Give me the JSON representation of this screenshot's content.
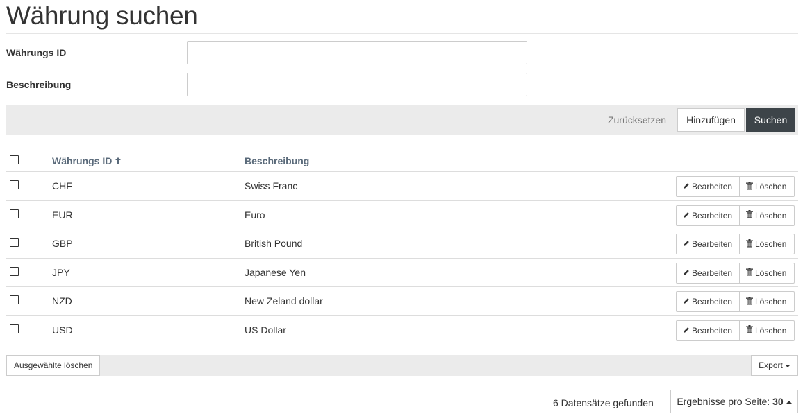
{
  "page": {
    "title": "Währung suchen"
  },
  "form": {
    "id_label": "Währungs ID",
    "id_value": "",
    "desc_label": "Beschreibung",
    "desc_value": ""
  },
  "actions": {
    "reset_label": "Zurücksetzen",
    "add_label": "Hinzufügen",
    "search_label": "Suchen"
  },
  "table": {
    "headers": {
      "id": "Währungs ID",
      "description": "Beschreibung"
    },
    "sort_icon": "arrow-up-icon",
    "edit_label": "Bearbeiten",
    "delete_label": "Löschen",
    "rows": [
      {
        "id": "CHF",
        "description": "Swiss Franc"
      },
      {
        "id": "EUR",
        "description": "Euro"
      },
      {
        "id": "GBP",
        "description": "British Pound"
      },
      {
        "id": "JPY",
        "description": "Japanese Yen"
      },
      {
        "id": "NZD",
        "description": "New Zeland dollar"
      },
      {
        "id": "USD",
        "description": "US Dollar"
      }
    ]
  },
  "footer": {
    "delete_selected_label": "Ausgewählte löschen",
    "export_label": "Export",
    "records_found": "6 Datensätze gefunden",
    "per_page_label": "Ergebnisse pro Seite:",
    "per_page_value": "30"
  },
  "colors": {
    "primary_button": "#3d4449",
    "header_text": "#5a6a7a",
    "bar_background": "#ebebeb"
  }
}
